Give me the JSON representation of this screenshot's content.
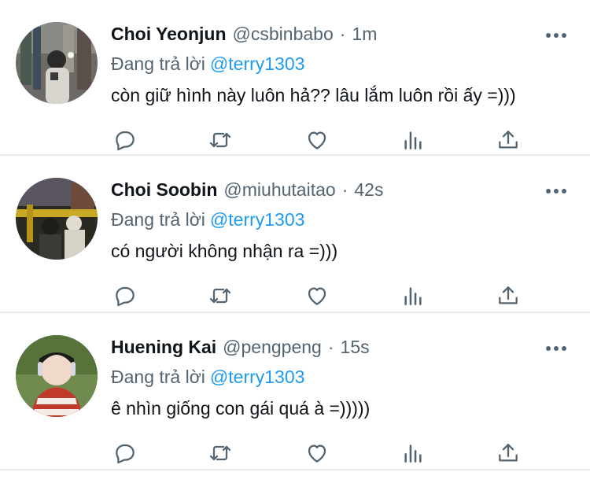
{
  "tweets": [
    {
      "display_name": "Choi Yeonjun",
      "handle": "@csbinbabo",
      "separator": "·",
      "time": "1m",
      "reply_prefix": "Đang trả lời",
      "reply_to": "@terry1303",
      "text": "còn giữ hình này luôn hả?? lâu lắm luôn rồi ấy =)))"
    },
    {
      "display_name": "Choi Soobin",
      "handle": "@miuhutaitao",
      "separator": "·",
      "time": "42s",
      "reply_prefix": "Đang trả lời",
      "reply_to": "@terry1303",
      "text": "có người không nhận ra =)))"
    },
    {
      "display_name": "Huening Kai",
      "handle": "@pengpeng",
      "separator": "·",
      "time": "15s",
      "reply_prefix": "Đang trả lời",
      "reply_to": "@terry1303",
      "text": "ê nhìn giống con gái quá à =)))))"
    }
  ],
  "icons": {
    "more": "more-horizontal-icon",
    "reply": "reply-icon",
    "retweet": "retweet-icon",
    "like": "heart-icon",
    "analytics": "analytics-icon",
    "share": "share-icon"
  },
  "colors": {
    "text": "#0f1419",
    "secondary": "#536471",
    "mention": "#1d9bf0",
    "divider": "#e6ecf0"
  }
}
